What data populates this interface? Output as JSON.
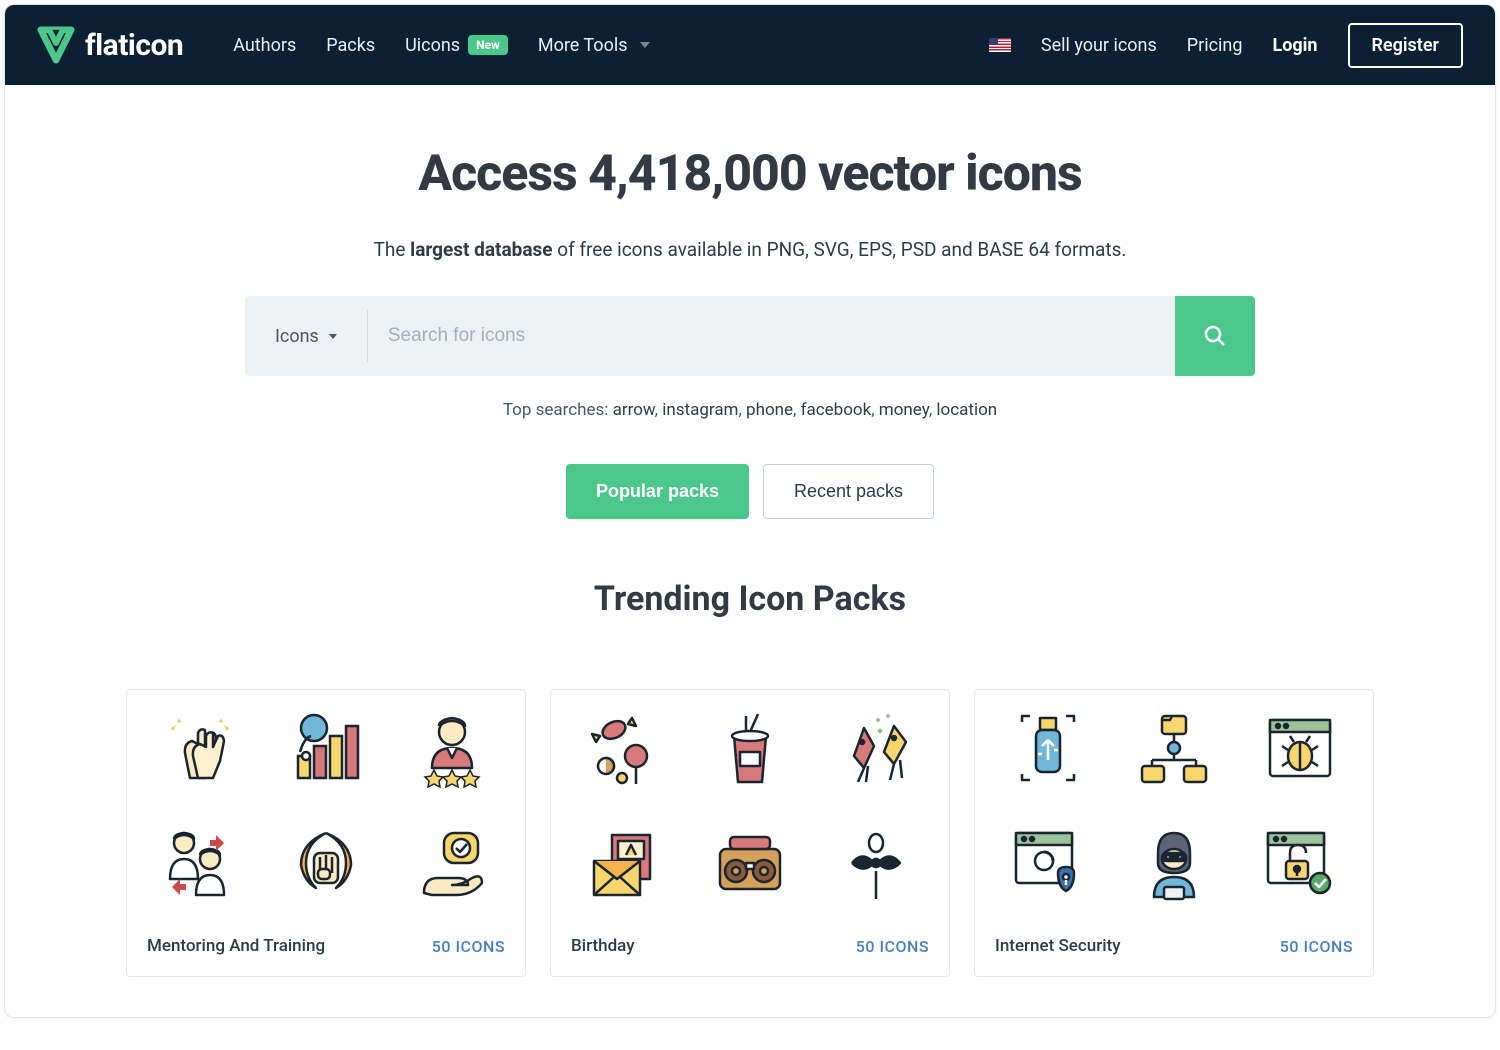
{
  "brand": {
    "name": "flaticon"
  },
  "nav": {
    "authors": "Authors",
    "packs": "Packs",
    "uicons": "Uicons",
    "uicons_badge": "New",
    "more_tools": "More Tools"
  },
  "header_right": {
    "sell": "Sell your icons",
    "pricing": "Pricing",
    "login": "Login",
    "register": "Register"
  },
  "hero": {
    "title": "Access 4,418,000 vector icons",
    "sub_pre": "The ",
    "sub_bold": "largest database",
    "sub_post": " of free icons available in PNG, SVG, EPS, PSD and BASE 64 formats."
  },
  "search": {
    "type": "Icons",
    "placeholder": "Search for icons"
  },
  "top_searches": {
    "label": "Top searches: ",
    "items": [
      "arrow",
      "instagram",
      "phone",
      "facebook",
      "money",
      "location"
    ]
  },
  "buttons": {
    "popular": "Popular packs",
    "recent": "Recent packs"
  },
  "trending": {
    "heading": "Trending Icon Packs",
    "packs": [
      {
        "name": "Mentoring And Training",
        "count": "50 ICONS"
      },
      {
        "name": "Birthday",
        "count": "50 ICONS"
      },
      {
        "name": "Internet Security",
        "count": "50 ICONS"
      }
    ]
  }
}
